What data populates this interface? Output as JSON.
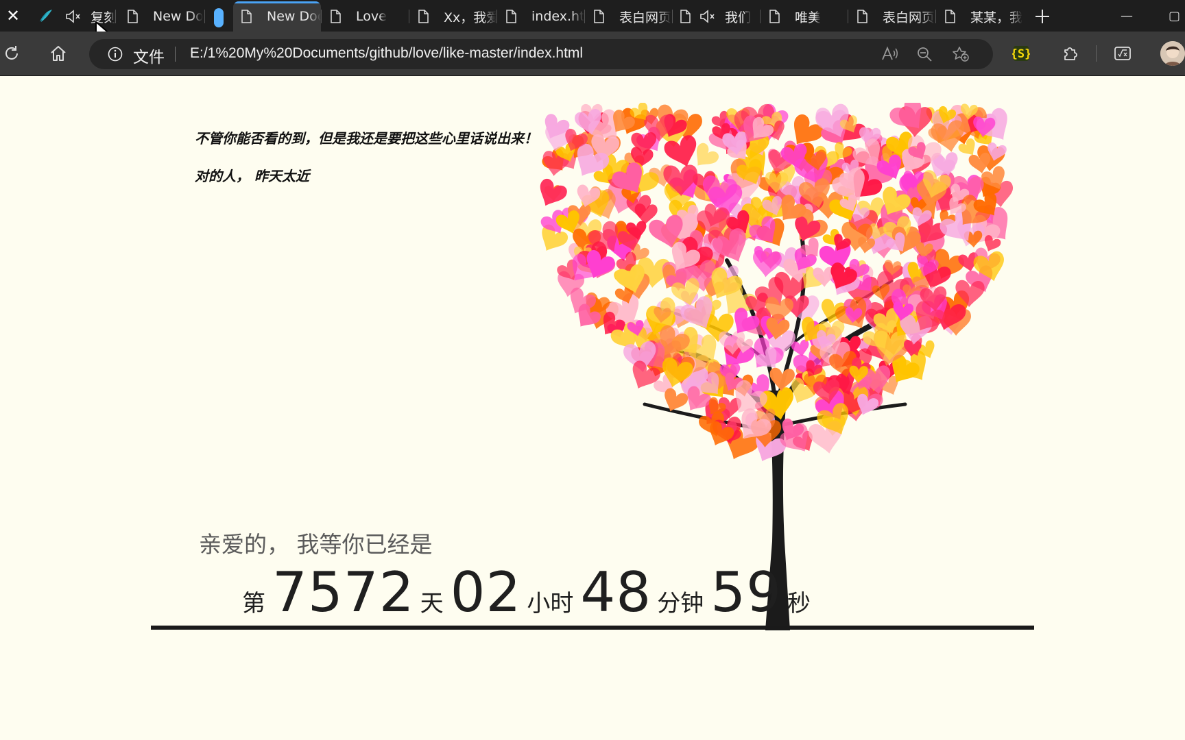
{
  "tabs": [
    {
      "title": "复刻",
      "muted": true
    },
    {
      "title": "New Doc"
    },
    {
      "title": "New Doc",
      "active": true
    },
    {
      "title": "Love"
    },
    {
      "title": "Xx，我爱"
    },
    {
      "title": "index.htm"
    },
    {
      "title": "表白网页"
    },
    {
      "title": "我们",
      "muted": true
    },
    {
      "title": "唯美"
    },
    {
      "title": "表白网页"
    },
    {
      "title": "某某，我"
    }
  ],
  "window_controls": {
    "minimize": "—",
    "restore": "▢"
  },
  "address_bar": {
    "protocol_label": "文件",
    "url": "E:/1%20My%20Documents/github/love/like-master/index.html"
  },
  "page": {
    "message_lines": [
      "不管你能否看的到，但是我还是要把这些心里话说出来！",
      "对的人， 昨天太近"
    ],
    "dear_text": "亲爱的， 我等你已经是",
    "counter": {
      "prefix": "第",
      "days": "7572",
      "days_unit": "天",
      "hours": "02",
      "hours_unit": "小时",
      "minutes": "48",
      "minutes_unit": "分钟",
      "seconds": "59",
      "seconds_unit": "秒"
    }
  },
  "colors": {
    "page_background": "#fefdf0",
    "active_tab_indicator": "#4aa3f5",
    "heart_palette": [
      "#ff2e5b",
      "#ff5fa2",
      "#ff8a3d",
      "#ffd23f",
      "#ff3fd0",
      "#ffb3c7",
      "#ff6a00",
      "#f7a8e0",
      "#ff1744",
      "#ffc400"
    ]
  },
  "icons": {
    "tab_close": "close-icon",
    "browser_logo": "feather-logo-icon",
    "mute": "speaker-muted-icon",
    "doc": "document-icon",
    "new_tab": "plus-icon",
    "reload": "reload-icon",
    "home": "home-icon",
    "info": "info-icon",
    "read_aloud": "read-aloud-icon",
    "zoom": "zoom-out-icon",
    "favorite": "add-favorite-icon",
    "extension_code": "code-extension-icon",
    "extensions": "puzzle-icon",
    "formula": "formula-extension-icon"
  }
}
